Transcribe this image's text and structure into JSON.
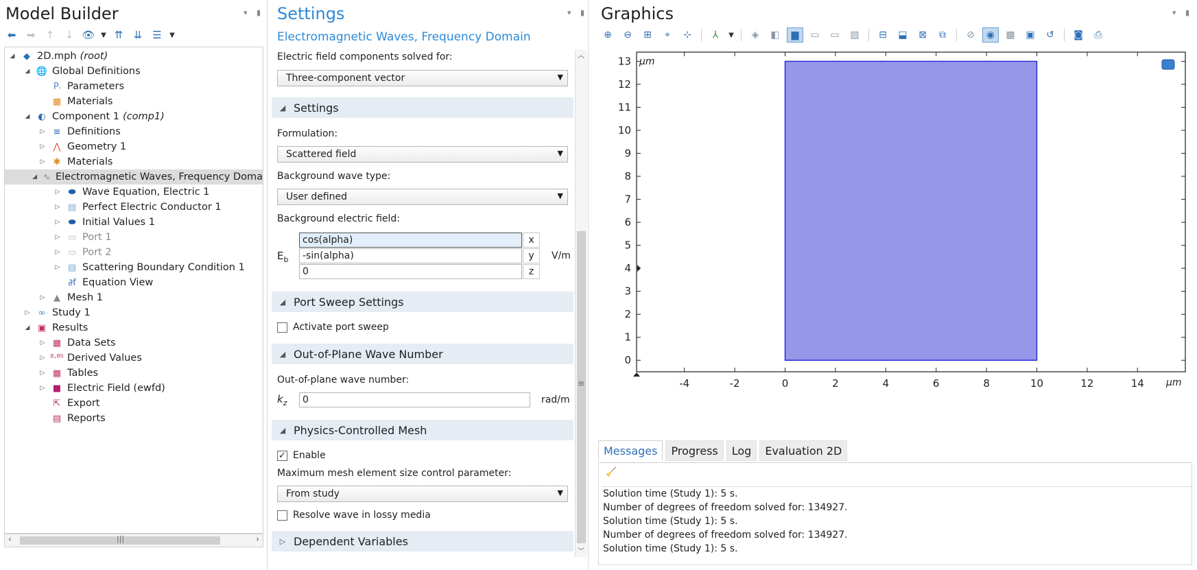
{
  "model_builder": {
    "title": "Model Builder",
    "tree": [
      {
        "label": "2D.mph",
        "suffix": "(root)",
        "level": 0,
        "toggle": "open",
        "icon": "root-icon",
        "color": "#2d6fb5",
        "glyph": "◆"
      },
      {
        "label": "Global Definitions",
        "level": 1,
        "toggle": "open",
        "icon": "globe-icon",
        "color": "#2d6fb5",
        "glyph": "🌐"
      },
      {
        "label": "Parameters",
        "level": 2,
        "toggle": "",
        "icon": "parameters-icon",
        "color": "#5b8fc9",
        "glyph": "Pᵢ"
      },
      {
        "label": "Materials",
        "level": 2,
        "toggle": "",
        "icon": "materials-icon",
        "color": "#e08a1e",
        "glyph": "▦"
      },
      {
        "label": "Component 1",
        "suffix": "(comp1)",
        "level": 1,
        "toggle": "open",
        "icon": "component-icon",
        "color": "#2d6fb5",
        "glyph": "◐"
      },
      {
        "label": "Definitions",
        "level": 2,
        "toggle": "closed",
        "icon": "definitions-icon",
        "color": "#2d6fb5",
        "glyph": "≡"
      },
      {
        "label": "Geometry 1",
        "level": 2,
        "toggle": "closed",
        "icon": "geometry-icon",
        "color": "#e0552b",
        "glyph": "⋀"
      },
      {
        "label": "Materials",
        "level": 2,
        "toggle": "closed",
        "icon": "materials-icon",
        "color": "#e08a1e",
        "glyph": "✱"
      },
      {
        "label": "Electromagnetic Waves, Frequency Doma",
        "level": 2,
        "toggle": "open",
        "icon": "em-waves-icon",
        "color": "#7a8aa8",
        "glyph": "∿",
        "selected": true
      },
      {
        "label": "Wave Equation, Electric 1",
        "level": 3,
        "toggle": "closed",
        "icon": "domain-feature-icon",
        "color": "#1f5fa8",
        "glyph": "⬬"
      },
      {
        "label": "Perfect Electric Conductor 1",
        "level": 3,
        "toggle": "closed",
        "icon": "boundary-feature-icon",
        "color": "#7fa7d6",
        "glyph": "▤"
      },
      {
        "label": "Initial Values 1",
        "level": 3,
        "toggle": "closed",
        "icon": "domain-feature-icon",
        "color": "#1f5fa8",
        "glyph": "⬬"
      },
      {
        "label": "Port 1",
        "level": 3,
        "toggle": "closed",
        "icon": "port-icon",
        "color": "#bbbbbb",
        "glyph": "▭",
        "dim": true
      },
      {
        "label": "Port 2",
        "level": 3,
        "toggle": "closed",
        "icon": "port-icon",
        "color": "#bbbbbb",
        "glyph": "▭",
        "dim": true
      },
      {
        "label": "Scattering Boundary Condition 1",
        "level": 3,
        "toggle": "closed",
        "icon": "boundary-feature-icon",
        "color": "#7fa7d6",
        "glyph": "▤"
      },
      {
        "label": "Equation View",
        "level": 3,
        "toggle": "",
        "icon": "equation-view-icon",
        "color": "#2d6fb5",
        "glyph": "∂f"
      },
      {
        "label": "Mesh 1",
        "level": 2,
        "toggle": "closed",
        "icon": "mesh-icon",
        "color": "#888888",
        "glyph": "▲"
      },
      {
        "label": "Study 1",
        "level": 1,
        "toggle": "closed",
        "icon": "study-icon",
        "color": "#2d8ad6",
        "glyph": "∞"
      },
      {
        "label": "Results",
        "level": 1,
        "toggle": "open",
        "icon": "results-icon",
        "color": "#c0305a",
        "glyph": "▣"
      },
      {
        "label": "Data Sets",
        "level": 2,
        "toggle": "closed",
        "icon": "datasets-icon",
        "color": "#c0305a",
        "glyph": "▦"
      },
      {
        "label": "Derived Values",
        "level": 2,
        "toggle": "closed",
        "icon": "derived-values-icon",
        "color": "#c0305a",
        "glyph": "⁸·⁸⁵"
      },
      {
        "label": "Tables",
        "level": 2,
        "toggle": "closed",
        "icon": "tables-icon",
        "color": "#c0305a",
        "glyph": "▦"
      },
      {
        "label": "Electric Field (ewfd)",
        "level": 2,
        "toggle": "closed",
        "icon": "plot-group-icon",
        "color": "#b01e6a",
        "glyph": "■"
      },
      {
        "label": "Export",
        "level": 2,
        "toggle": "",
        "icon": "export-icon",
        "color": "#c0305a",
        "glyph": "⇱"
      },
      {
        "label": "Reports",
        "level": 2,
        "toggle": "",
        "icon": "reports-icon",
        "color": "#c0305a",
        "glyph": "▤"
      }
    ]
  },
  "settings": {
    "title": "Settings",
    "subtitle": "Electromagnetic Waves, Frequency Domain",
    "components_label": "Electric field components solved for:",
    "components_value": "Three-component vector",
    "section_settings": "Settings",
    "formulation_label": "Formulation:",
    "formulation_value": "Scattered field",
    "bg_wave_type_label": "Background wave type:",
    "bg_wave_type_value": "User defined",
    "bg_field_label": "Background electric field:",
    "eb_symbol": "E",
    "eb_sub": "b",
    "eb_x": "cos(alpha)",
    "eb_y": "-sin(alpha)",
    "eb_z": "0",
    "coord_x": "x",
    "coord_y": "y",
    "coord_z": "z",
    "eb_unit": "V/m",
    "section_port_sweep": "Port Sweep Settings",
    "activate_port_sweep": "Activate port sweep",
    "section_oop": "Out-of-Plane Wave Number",
    "oop_label": "Out-of-plane wave number:",
    "kz_symbol": "k",
    "kz_sub": "z",
    "kz_value": "0",
    "kz_unit": "rad/m",
    "section_pcm": "Physics-Controlled Mesh",
    "enable_label": "Enable",
    "enable_checked": true,
    "max_mesh_label": "Maximum mesh element size control parameter:",
    "max_mesh_value": "From study",
    "resolve_label": "Resolve wave in lossy media",
    "resolve_checked": false,
    "section_dep_vars": "Dependent Variables"
  },
  "graphics": {
    "title": "Graphics",
    "axis_unit": "μm",
    "x_ticks": [
      -4,
      -2,
      0,
      2,
      4,
      6,
      8,
      10,
      12,
      14
    ],
    "y_ticks": [
      0,
      1,
      2,
      3,
      4,
      5,
      6,
      7,
      8,
      9,
      10,
      11,
      12,
      13
    ],
    "x_range": [
      -5.9,
      15.9
    ],
    "y_range": [
      -0.5,
      13.4
    ],
    "domain_rect": {
      "x0": 0,
      "x1": 10,
      "y0": 0,
      "y1": 13
    },
    "domain_fill": "#9598e8",
    "domain_stroke": "#2b2bd6"
  },
  "messages": {
    "tabs": [
      "Messages",
      "Progress",
      "Log",
      "Evaluation 2D"
    ],
    "lines": [
      "Solution time (Study 1): 5 s.",
      "Number of degrees of freedom solved for: 134927.",
      "Solution time (Study 1): 5 s.",
      "Number of degrees of freedom solved for: 134927.",
      "Solution time (Study 1): 5 s."
    ]
  }
}
